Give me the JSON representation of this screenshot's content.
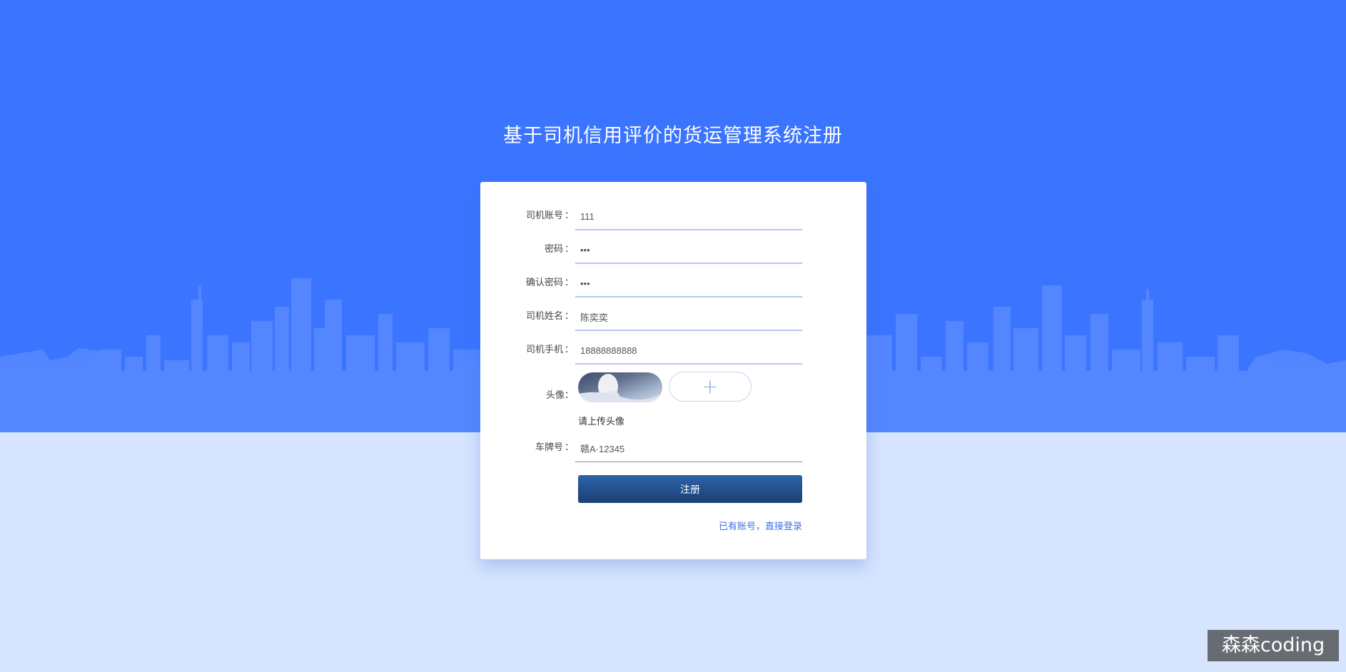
{
  "page": {
    "title": "基于司机信用评价的货运管理系统注册"
  },
  "form": {
    "colon": "：",
    "fields": [
      {
        "label": "司机账号",
        "value": "111"
      },
      {
        "label": "密码",
        "value": "•••"
      },
      {
        "label": "确认密码",
        "value": "•••"
      },
      {
        "label": "司机姓名",
        "value": "陈奕奕"
      },
      {
        "label": "司机手机",
        "value": "18888888888"
      }
    ],
    "avatar": {
      "label": "头像",
      "hint": "请上传头像",
      "upload_symbol": "+"
    },
    "plate": {
      "label": "车牌号",
      "value": "赣A·12345"
    },
    "submit_label": "注册",
    "login_link": "已有账号，直接登录"
  },
  "watermark": "森森coding",
  "colors": {
    "top_bg": "#3b74ff",
    "bottom_bg": "#d6e4fe",
    "button": "#1f4a88",
    "link": "#3d6fe8"
  }
}
